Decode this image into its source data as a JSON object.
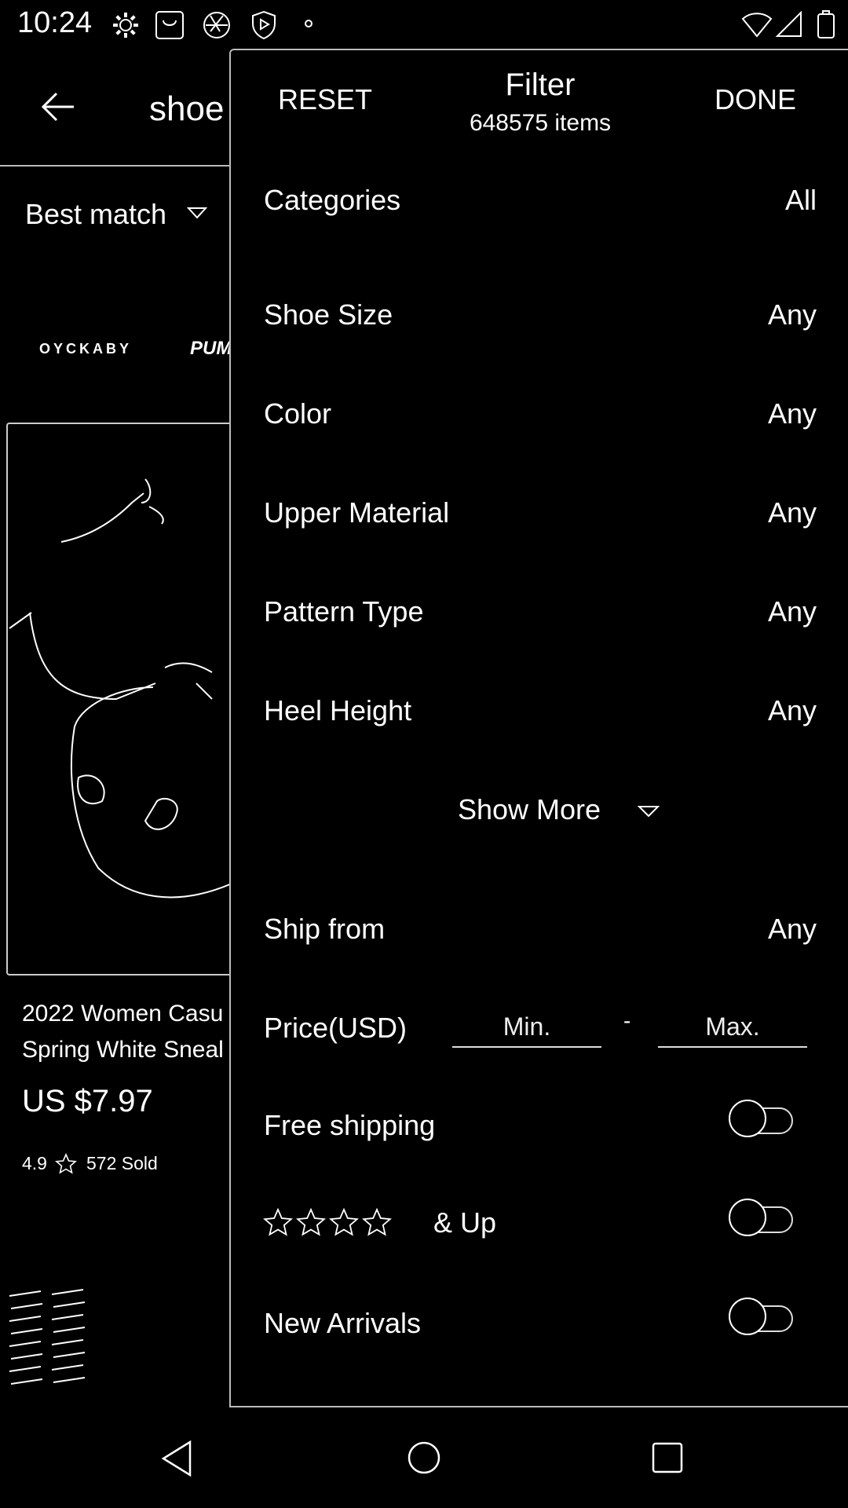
{
  "status_bar": {
    "time": "10:24",
    "left_icons": [
      "gear-icon",
      "bag-icon",
      "aperture-icon",
      "shield-play-icon",
      "dot-icon"
    ],
    "right_icons": [
      "wifi-icon",
      "signal-icon",
      "battery-icon"
    ]
  },
  "background_page": {
    "search_text": "shoe",
    "sort_label": "Best match",
    "brands": [
      "OYCKABY",
      "PUMA"
    ],
    "product": {
      "title_line1": "2022 Women Casu",
      "title_line2": "Spring White Sneal",
      "price": "US $7.97",
      "rating": "4.9",
      "sold": "572 Sold"
    }
  },
  "filter": {
    "reset_label": "RESET",
    "title": "Filter",
    "count": "648575 items",
    "done_label": "DONE",
    "rows": [
      {
        "label": "Categories",
        "value": "All"
      },
      {
        "label": "Shoe Size",
        "value": "Any"
      },
      {
        "label": "Color",
        "value": "Any"
      },
      {
        "label": "Upper Material",
        "value": "Any"
      },
      {
        "label": "Pattern Type",
        "value": "Any"
      },
      {
        "label": "Heel Height",
        "value": "Any"
      }
    ],
    "show_more_label": "Show More",
    "ship_from": {
      "label": "Ship from",
      "value": "Any"
    },
    "price": {
      "label": "Price(USD)",
      "min_placeholder": "Min.",
      "max_placeholder": "Max.",
      "separator": "-"
    },
    "free_shipping": {
      "label": "Free shipping",
      "on": false
    },
    "rating": {
      "stars": 4,
      "label": "& Up",
      "on": false
    },
    "new_arrivals": {
      "label": "New Arrivals",
      "on": false
    }
  },
  "nav_bar": {
    "icons": [
      "back-triangle-icon",
      "home-circle-icon",
      "recents-square-icon"
    ]
  }
}
